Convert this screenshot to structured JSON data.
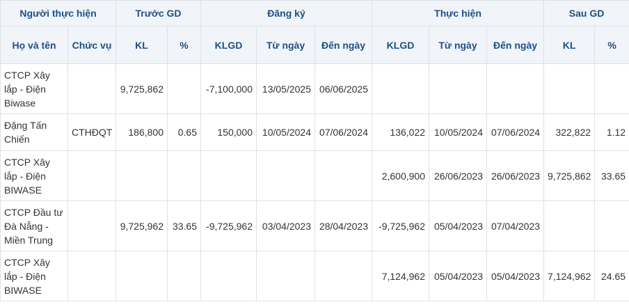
{
  "header": {
    "groups": [
      "Người thực hiện",
      "Trước GD",
      "Đăng ký",
      "Thực hiện",
      "Sau GD"
    ],
    "columns": [
      "Họ và tên",
      "Chức vụ",
      "KL",
      "%",
      "KLGD",
      "Từ ngày",
      "Đến ngày",
      "KLGD",
      "Từ ngày",
      "Đến ngày",
      "KL",
      "%"
    ]
  },
  "rows": [
    [
      "CTCP Xây lắp - Điện Biwase",
      "",
      "9,725,862",
      "",
      "-7,100,000",
      "13/05/2025",
      "06/06/2025",
      "",
      "",
      "",
      "",
      ""
    ],
    [
      "Đặng Tấn Chiến",
      "CTHĐQT",
      "186,800",
      "0.65",
      "150,000",
      "10/05/2024",
      "07/06/2024",
      "136,022",
      "10/05/2024",
      "07/06/2024",
      "322,822",
      "1.12"
    ],
    [
      "CTCP Xây lắp - Điện BIWASE",
      "",
      "",
      "",
      "",
      "",
      "",
      "2,600,900",
      "26/06/2023",
      "26/06/2023",
      "9,725,862",
      "33.65"
    ],
    [
      "CTCP Đầu tư Đà Nẵng - Miền Trung",
      "",
      "9,725,962",
      "33.65",
      "-9,725,962",
      "03/04/2023",
      "28/04/2023",
      "-9,725,962",
      "05/04/2023",
      "07/04/2023",
      "",
      ""
    ],
    [
      "CTCP Xây lắp - Điện BIWASE",
      "",
      "",
      "",
      "",
      "",
      "",
      "7,124,962",
      "05/04/2023",
      "05/04/2023",
      "7,124,962",
      "24.65"
    ]
  ]
}
